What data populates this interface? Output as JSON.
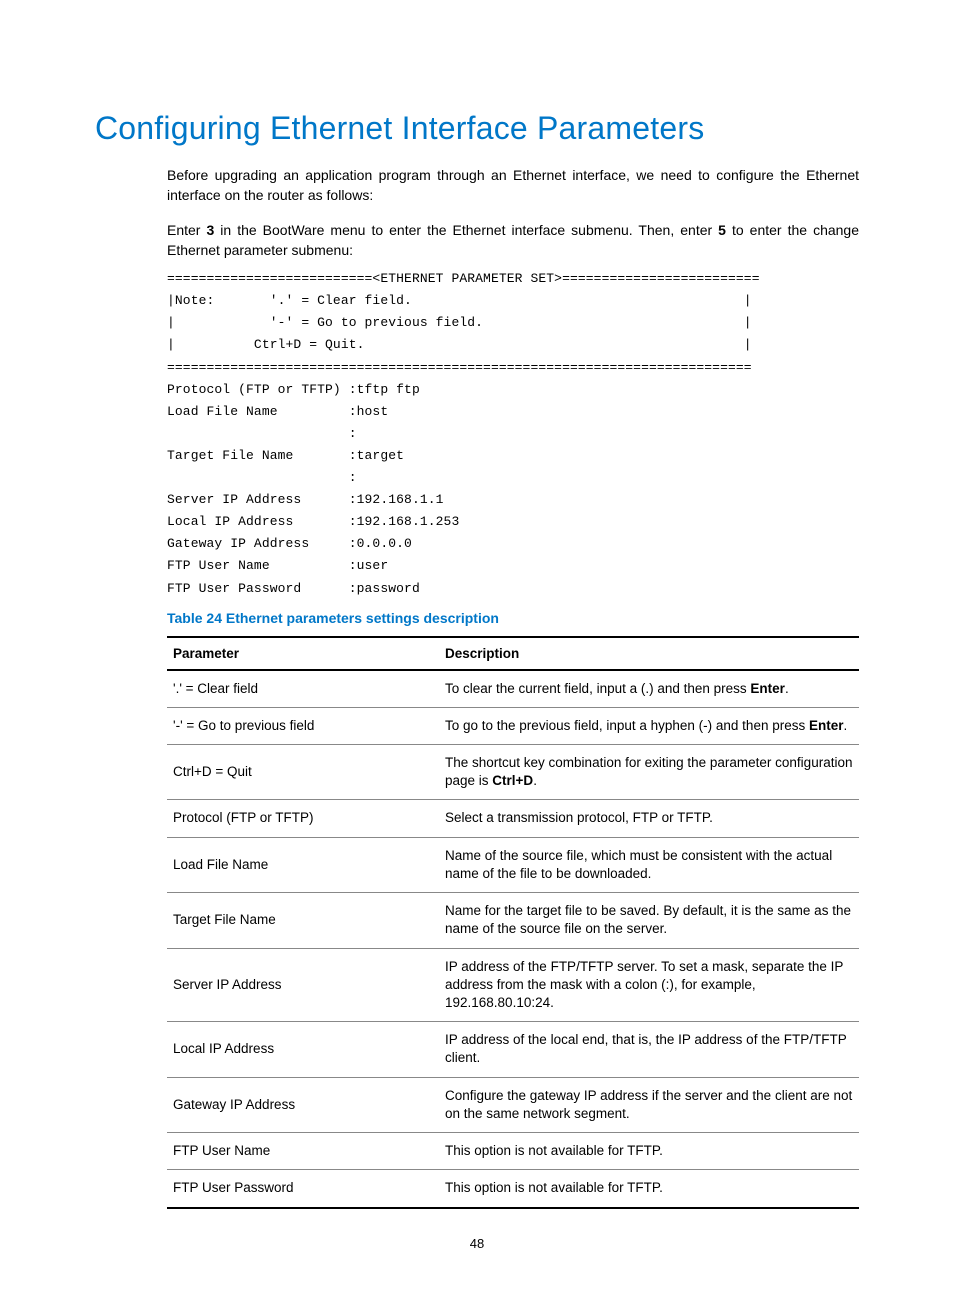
{
  "title": "Configuring Ethernet Interface Parameters",
  "paragraphs": {
    "p1": "Before upgrading an application program through an Ethernet interface, we need to configure the Ethernet interface on the router as follows:",
    "p2_a": "Enter ",
    "p2_b": "3",
    "p2_c": " in the BootWare menu to enter the Ethernet interface submenu. Then, enter ",
    "p2_d": "5",
    "p2_e": " to enter the change Ethernet parameter submenu:"
  },
  "code_block": "==========================<ETHERNET PARAMETER SET>=========================\n|Note:       '.' = Clear field.                                          |\n|            '-' = Go to previous field.                                 |\n|          Ctrl+D = Quit.                                                |\n==========================================================================\nProtocol (FTP or TFTP) :tftp ftp\nLoad File Name         :host\n                       :\nTarget File Name       :target\n                       :\nServer IP Address      :192.168.1.1\nLocal IP Address       :192.168.1.253\nGateway IP Address     :0.0.0.0\nFTP User Name          :user\nFTP User Password      :password",
  "table_caption": "Table 24 Ethernet parameters settings description",
  "table": {
    "headers": {
      "h1": "Parameter",
      "h2": "Description"
    },
    "rows": [
      {
        "param": "'.' = Clear field",
        "desc_a": "To clear the current field, input a (.) and then press ",
        "desc_b": "Enter",
        "desc_c": "."
      },
      {
        "param": "'-' = Go to previous field",
        "desc_a": "To go to the previous field, input a hyphen (-) and then press ",
        "desc_b": "Enter",
        "desc_c": "."
      },
      {
        "param": "Ctrl+D = Quit",
        "desc_a": "The shortcut key combination for exiting the parameter configuration page is ",
        "desc_b": "Ctrl+D",
        "desc_c": "."
      },
      {
        "param": "Protocol (FTP or TFTP)",
        "desc_a": "Select a transmission protocol, FTP or TFTP.",
        "desc_b": "",
        "desc_c": ""
      },
      {
        "param": "Load File Name",
        "desc_a": "Name of the source file, which must be consistent with the actual name of the file to be downloaded.",
        "desc_b": "",
        "desc_c": ""
      },
      {
        "param": "Target File Name",
        "desc_a": "Name for the target file to be saved. By default, it is the same as the name of the source file on the server.",
        "desc_b": "",
        "desc_c": ""
      },
      {
        "param": "Server IP Address",
        "desc_a": "IP address of the FTP/TFTP server. To set a mask, separate the IP address from the mask with a colon (:), for example, 192.168.80.10:24.",
        "desc_b": "",
        "desc_c": ""
      },
      {
        "param": "Local IP Address",
        "desc_a": "IP address of the local end, that is, the IP address of the FTP/TFTP client.",
        "desc_b": "",
        "desc_c": ""
      },
      {
        "param": "Gateway IP Address",
        "desc_a": "Configure the gateway IP address if the server and the client are not on the same network segment.",
        "desc_b": "",
        "desc_c": ""
      },
      {
        "param": "FTP User Name",
        "desc_a": "This option is not available for TFTP.",
        "desc_b": "",
        "desc_c": ""
      },
      {
        "param": "FTP User Password",
        "desc_a": "This option is not available for TFTP.",
        "desc_b": "",
        "desc_c": ""
      }
    ]
  },
  "page_number": "48"
}
